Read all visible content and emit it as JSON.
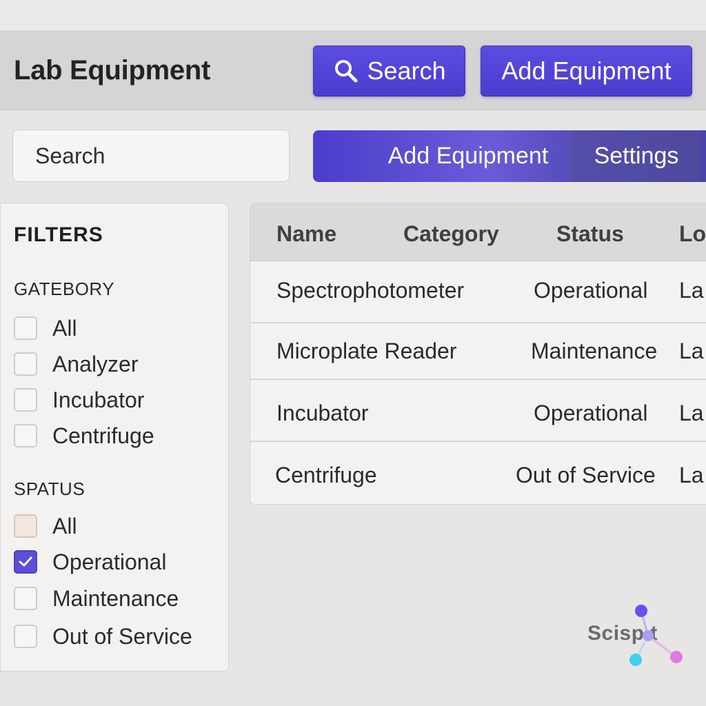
{
  "header": {
    "title": "Lab Equipment",
    "search_button": "Search",
    "add_button": "Add Equipment"
  },
  "toolbar": {
    "search_placeholder": "Search",
    "add_tab": "Add Equipment",
    "settings_tab": "Settings"
  },
  "filters": {
    "title": "FILTERS",
    "category": {
      "title": "GATEBORY",
      "options": [
        {
          "label": "All",
          "checked": false
        },
        {
          "label": "Analyzer",
          "checked": false
        },
        {
          "label": "Incubator",
          "checked": false
        },
        {
          "label": "Centrifuge",
          "checked": false
        }
      ]
    },
    "status": {
      "title": "SPATUS",
      "options": [
        {
          "label": "All",
          "checked": false
        },
        {
          "label": "Operational",
          "checked": true
        },
        {
          "label": "Maintenance",
          "checked": false
        },
        {
          "label": "Out of Service",
          "checked": false
        }
      ]
    }
  },
  "table": {
    "columns": [
      "Name",
      "Category",
      "Status",
      "Lo"
    ],
    "rows": [
      {
        "name": "Spectrophotometer",
        "status": "Operational",
        "location": "La"
      },
      {
        "name": "Microplate Reader",
        "status": "Maintenance",
        "location": "La"
      },
      {
        "name": "Incubator",
        "status": "Operational",
        "location": "La"
      },
      {
        "name": "Centrifuge",
        "status": "Out of Service",
        "location": "La"
      }
    ]
  },
  "brand": {
    "logo_text": "Scisp  t",
    "accent": "#5a4fd6"
  }
}
